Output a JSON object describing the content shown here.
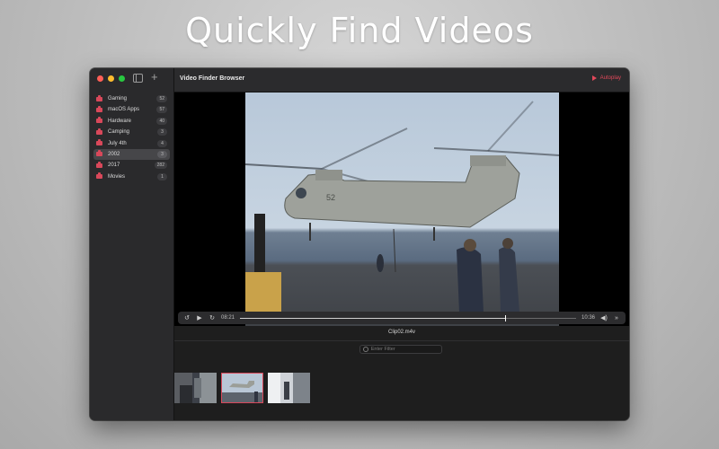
{
  "headline": "Quickly Find Videos",
  "colors": {
    "accent": "#d8485a",
    "window_bg": "#1f1f1f",
    "sidebar_bg": "#2a2a2c"
  },
  "toolbar": {
    "sidebar_toggle_icon": "sidebar-toggle-icon",
    "add_icon": "plus-icon",
    "add_label": "+"
  },
  "sidebar": {
    "items": [
      {
        "label": "Gaming",
        "count": "52"
      },
      {
        "label": "macOS Apps",
        "count": "57"
      },
      {
        "label": "Hardware",
        "count": "40"
      },
      {
        "label": "Camping",
        "count": "3"
      },
      {
        "label": "July 4th",
        "count": "4"
      },
      {
        "label": "2002",
        "count": "3",
        "selected": true
      },
      {
        "label": "2017",
        "count": "282"
      },
      {
        "label": "Movies",
        "count": "1"
      }
    ]
  },
  "header": {
    "title": "Video Finder Browser",
    "autoplay_label": "Autoplay"
  },
  "player": {
    "elapsed": "08:21",
    "duration": "10:36",
    "progress": 0.79,
    "icons": [
      "skip-back-icon",
      "play-icon",
      "skip-forward-icon",
      "volume-icon",
      "next-icon"
    ]
  },
  "filename": "Clip02.m4v",
  "filter": {
    "placeholder": "Enter Filter"
  },
  "thumbnails": [
    {
      "name": "clip01"
    },
    {
      "name": "clip02",
      "selected": true
    },
    {
      "name": "clip03"
    }
  ]
}
